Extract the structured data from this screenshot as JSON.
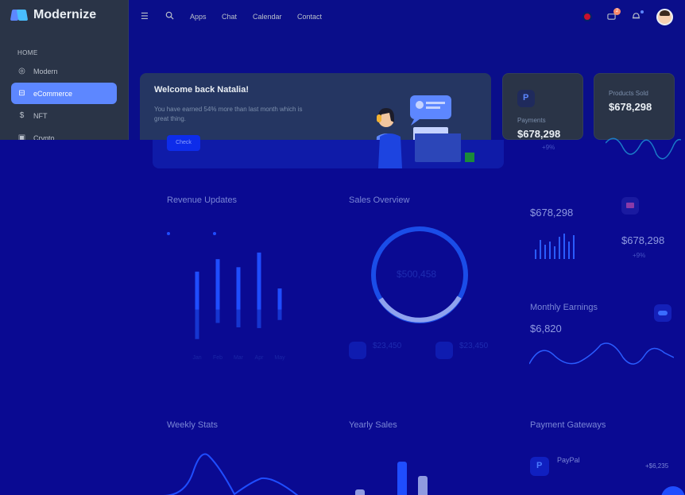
{
  "app": {
    "name": "Modernize"
  },
  "sidebar": {
    "heading_home": "HOME",
    "items": [
      {
        "label": "Modern",
        "icon": "aperture-icon"
      },
      {
        "label": "eCommerce",
        "icon": "cart-icon",
        "active": true
      },
      {
        "label": "NFT",
        "icon": "dollar-icon"
      },
      {
        "label": "Crypto",
        "icon": "cpu-icon"
      }
    ]
  },
  "topbar": {
    "nav": [
      "Apps",
      "Chat",
      "Calendar",
      "Contact"
    ],
    "cart_badge": "2"
  },
  "welcome": {
    "title": "Welcome back Natalia!",
    "text": "You have earned 54% more than last month which is great thing.",
    "button": "Check"
  },
  "cards": {
    "payments": {
      "label": "Payments",
      "value": "$678,298",
      "change": "+9%"
    },
    "products_sold": {
      "label": "Products Sold",
      "value": "$678,298"
    }
  },
  "overlay": {
    "revenue": {
      "title": "Revenue Updates"
    },
    "sales": {
      "title": "Sales Overview",
      "center": "$500,458",
      "stat_a": "$23,450",
      "stat_b": "$23,450"
    },
    "right_stats": {
      "value_a": "$678,298",
      "value_b": "$678,298",
      "change_b": "+9%"
    },
    "monthly": {
      "title": "Monthly Earnings",
      "value": "$6,820"
    },
    "weekly": {
      "title": "Weekly Stats"
    },
    "yearly": {
      "title": "Yearly Sales"
    },
    "gateways": {
      "title": "Payment Gateways",
      "item": "PayPal",
      "amount": "+$6,235"
    }
  },
  "chart_data": {
    "type": "bar",
    "title": "Revenue Updates",
    "categories": [
      "Jan",
      "Feb",
      "Mar",
      "Apr",
      "May"
    ],
    "series": [
      {
        "values": [
          5.2,
          6.9,
          5.8,
          7.8,
          2.9
        ]
      },
      {
        "values": [
          -4.0,
          -1.8,
          -2.4,
          -2.5,
          -1.4
        ]
      }
    ],
    "ylim": [
      -5,
      8
    ]
  },
  "colors": {
    "primary": "#5d87ff",
    "sidebar": "#2a3447",
    "overlay": "#0a0a92"
  }
}
